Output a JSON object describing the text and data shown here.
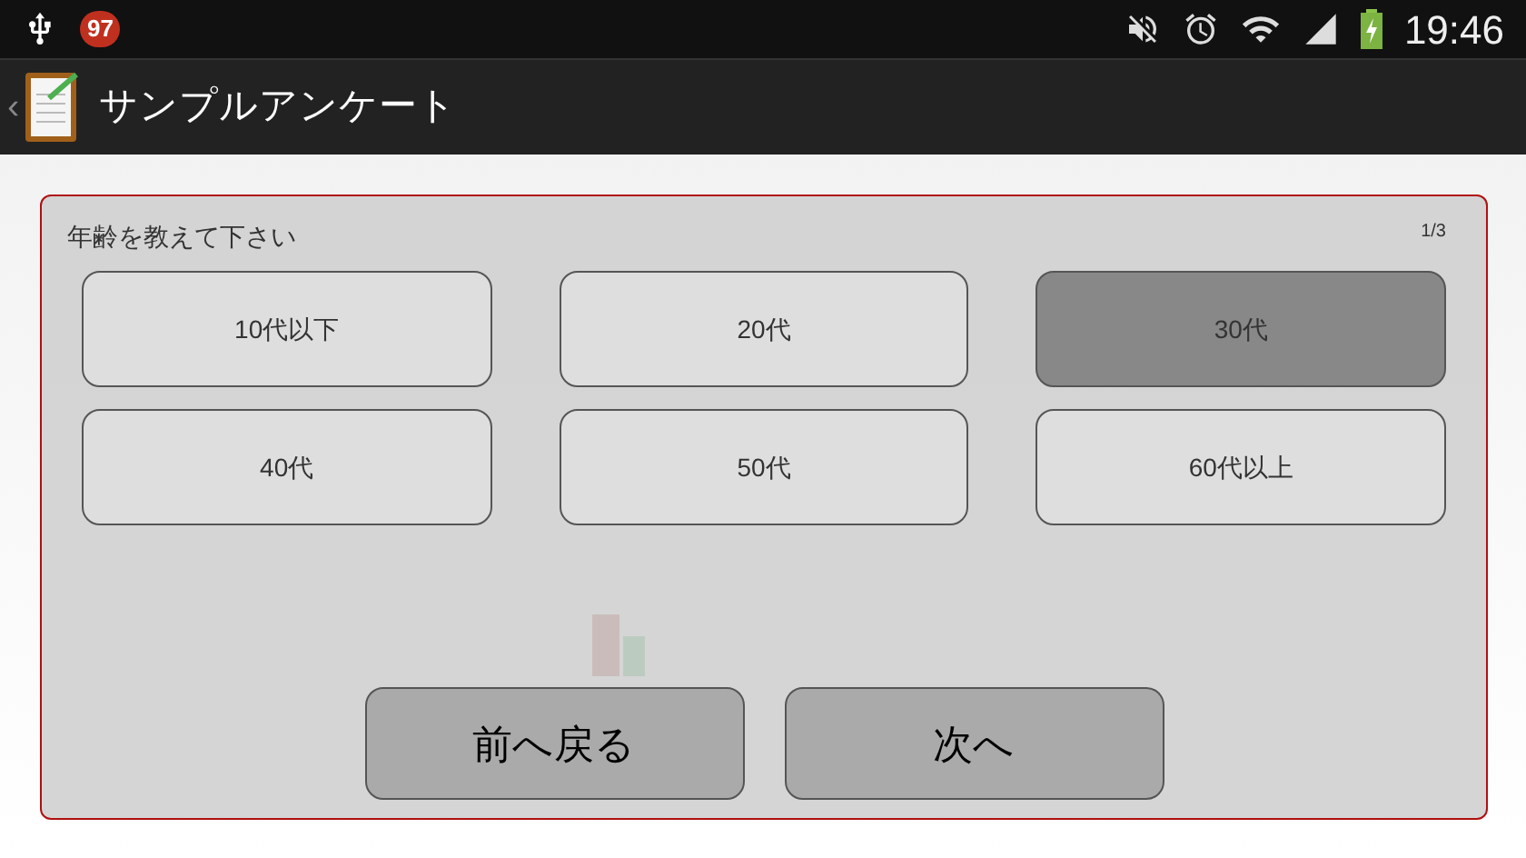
{
  "status_bar": {
    "notification_count": "97",
    "time": "19:46",
    "battery_charging": true
  },
  "action_bar": {
    "up_caret": "‹",
    "title": "サンプルアンケート"
  },
  "question": {
    "text": "年齢を教えて下さい",
    "page": "1/3",
    "options": [
      {
        "label": "10代以下",
        "selected": false
      },
      {
        "label": "20代",
        "selected": false
      },
      {
        "label": "30代",
        "selected": true
      },
      {
        "label": "40代",
        "selected": false
      },
      {
        "label": "50代",
        "selected": false
      },
      {
        "label": "60代以上",
        "selected": false
      }
    ]
  },
  "buttons": [
    {
      "label": "前へ戻る"
    },
    {
      "label": "次へ"
    }
  ]
}
